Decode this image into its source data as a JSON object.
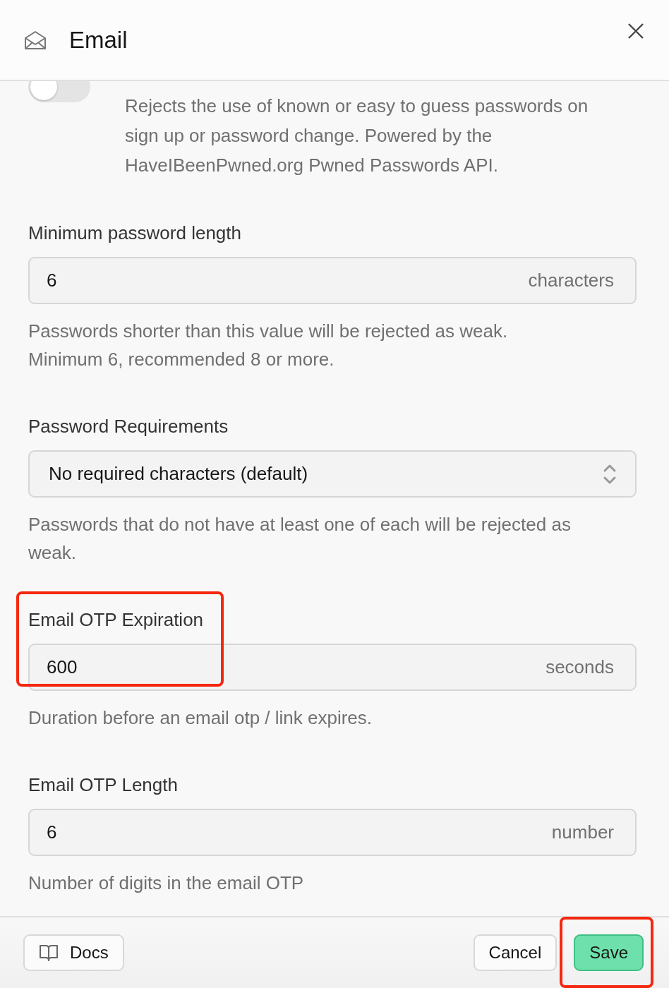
{
  "dialog": {
    "title": "Email"
  },
  "toggle": {
    "on": false,
    "description": "Rejects the use of known or easy to guess passwords on sign up or password change. Powered by the HaveIBeenPwned.org Pwned Passwords API."
  },
  "fields": [
    {
      "kind": "number",
      "label": "Minimum password length",
      "value": "6",
      "unit": "characters",
      "help": "Passwords shorter than this value will be rejected as weak.\nMinimum 6, recommended 8 or more.",
      "highlighted": false
    },
    {
      "kind": "select",
      "label": "Password Requirements",
      "value": "No required characters (default)",
      "help": "Passwords that do not have at least one of each will be rejected as weak.",
      "highlighted": false
    },
    {
      "kind": "number",
      "label": "Email OTP Expiration",
      "value": "600",
      "unit": "seconds",
      "help": "Duration before an email otp / link expires.",
      "highlighted": true
    },
    {
      "kind": "number",
      "label": "Email OTP Length",
      "value": "6",
      "unit": "number",
      "help": "Number of digits in the email OTP",
      "highlighted": false
    }
  ],
  "footer": {
    "docs": "Docs",
    "cancel": "Cancel",
    "save": {
      "label": "Save",
      "highlighted": true
    }
  }
}
